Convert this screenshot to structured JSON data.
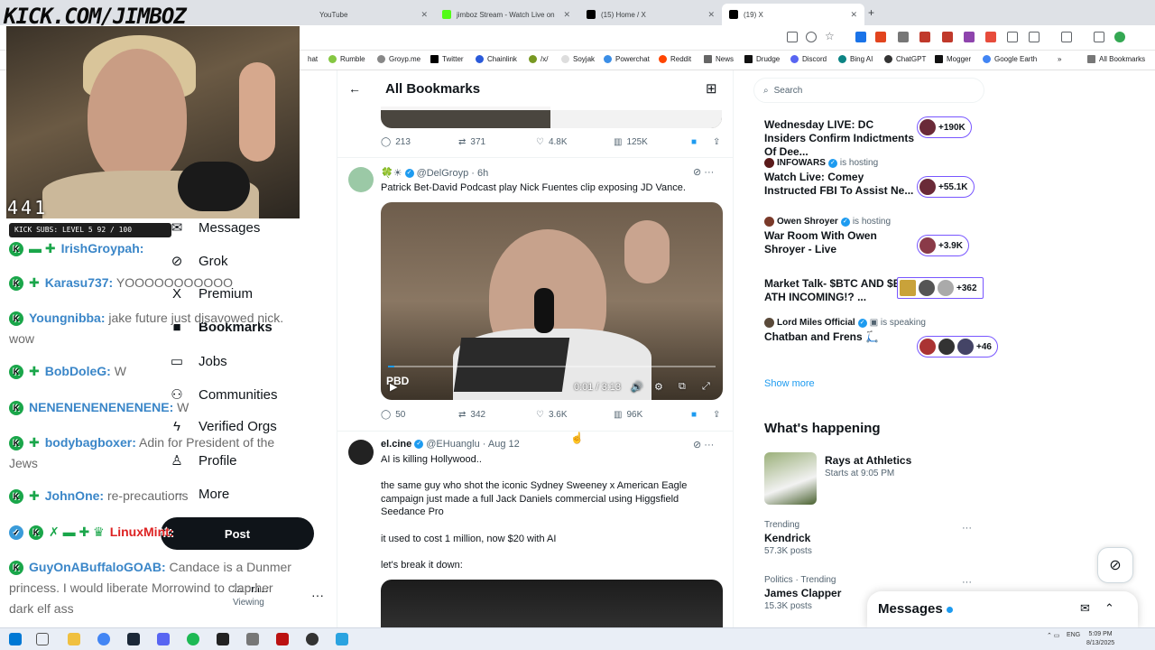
{
  "browser": {
    "tabs": [
      {
        "label": "YouTube",
        "color": "#ff0000"
      },
      {
        "label": "jimboz Stream - Watch Live on",
        "color": "#53fc18"
      },
      {
        "label": "(15) Home / X",
        "color": "#000000"
      },
      {
        "label": "(19) X",
        "color": "#000000"
      }
    ],
    "bookmarks": [
      "hat",
      "Rumble",
      "Groyp.me",
      "Twitter",
      "Chainlink",
      "/x/",
      "Soyjak",
      "Powerchat",
      "Reddit",
      "News",
      "Drudge",
      "Discord",
      "Bing AI",
      "ChatGPT",
      "Mogger",
      "Google Earth"
    ],
    "all_bookmarks": "All Bookmarks"
  },
  "stream": {
    "url_banner": "KICK.COM/JIMBOZ",
    "viewers": "441",
    "kick_subs": "KICK SUBS: LEVEL 5 92 / 100",
    "chat": [
      {
        "user": "IrishGroypah:",
        "msg": ""
      },
      {
        "user": "Karasu737:",
        "msg": "YOOOOOOOOOOO"
      },
      {
        "user": "Youngnibba:",
        "msg": "jake future just disavowed nick. wow"
      },
      {
        "user": "BobDoleG:",
        "msg": "W"
      },
      {
        "user": "NENENENENENENENE:",
        "msg": "W"
      },
      {
        "user": "bodybagboxer:",
        "msg": "Adin for President of the Jews"
      },
      {
        "user": "JohnOne:",
        "msg": "re-precautions"
      },
      {
        "user": "LinuxMint:",
        "msg": ""
      },
      {
        "user": "GuyOnABuffaloGOAB:",
        "msg": "Candace is a Dunmer princess. I would liberate Morrowind to clap her dark elf ass"
      }
    ]
  },
  "nav": {
    "items": [
      {
        "label": "Messages"
      },
      {
        "label": "Grok"
      },
      {
        "label": "Premium"
      },
      {
        "label": "Bookmarks"
      },
      {
        "label": "Jobs"
      },
      {
        "label": "Communities"
      },
      {
        "label": "Verified Orgs"
      },
      {
        "label": "Profile"
      },
      {
        "label": "More"
      }
    ],
    "post_label": "Post",
    "profile_name": "Zoomer",
    "profile_handle": "Viewing"
  },
  "main": {
    "title": "All Bookmarks",
    "tweet0": {
      "replies": "213",
      "reposts": "371",
      "likes": "4.8K",
      "views": "125K"
    },
    "tweet1": {
      "name": "",
      "handle": "@DelGroyp",
      "time": "6h",
      "text": "Patrick Bet-David Podcast play Nick Fuentes clip exposing JD Vance.",
      "video_time": "0:01 / 3:13",
      "video_progress": 0.005,
      "video_logo": "PBD",
      "replies": "50",
      "reposts": "342",
      "likes": "3.6K",
      "views": "96K"
    },
    "tweet2": {
      "name": "el.cine",
      "handle": "@EHuanglu",
      "time": "Aug 12",
      "p1": "AI is killing Hollywood..",
      "p2": "the same guy who shot the iconic Sydney Sweeney x American Eagle campaign just made a full Jack Daniels commercial using Higgsfield Seedance Pro",
      "p3": "it used to cost 1 million, now $20 with AI",
      "p4": "let's break it down:"
    }
  },
  "right": {
    "search_placeholder": "Search",
    "spaces": [
      {
        "host": "",
        "status": "",
        "title": "Wednesday LIVE: DC Insiders Confirm Indictments Of Dee...",
        "listeners": "+190K"
      },
      {
        "host": "INFOWARS",
        "status": "is hosting",
        "title": "Watch Live: Comey Instructed FBI To Assist Ne...",
        "listeners": "+55.1K"
      },
      {
        "host": "Owen Shroyer",
        "status": "is hosting",
        "title": "War Room With Owen Shroyer - Live",
        "listeners": "+3.9K"
      },
      {
        "host": "",
        "status": "",
        "title": "Market Talk- $BTC AND $ETH ATH INCOMING!? ...",
        "listeners": "+362"
      },
      {
        "host": "Lord Miles Official",
        "status": "is speaking",
        "title": "Chatban and Frens 🛴",
        "listeners": "+46"
      }
    ],
    "show_more": "Show more",
    "whats_happening": "What's happening",
    "event": {
      "title": "Rays at Athletics",
      "sub": "Starts at 9:05 PM"
    },
    "trends": [
      {
        "cat": "Trending",
        "name": "Kendrick",
        "count": "57.3K posts"
      },
      {
        "cat": "Politics · Trending",
        "name": "James Clapper",
        "count": "15.3K posts"
      }
    ],
    "messages_label": "Messages"
  },
  "taskbar": {
    "lang": "ENG",
    "time": "5:09 PM",
    "date": "8/13/2025"
  }
}
